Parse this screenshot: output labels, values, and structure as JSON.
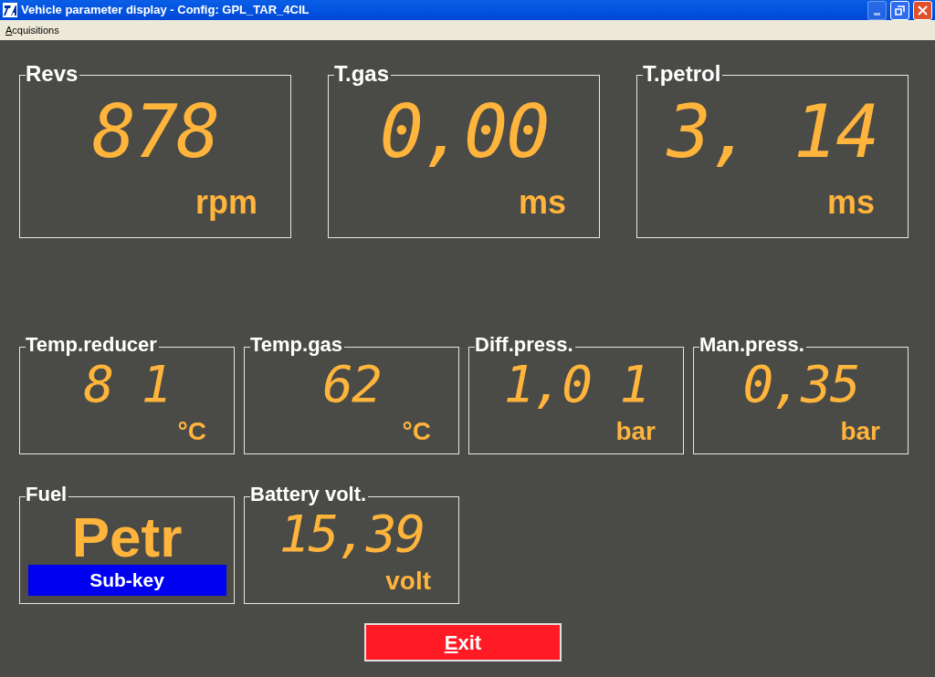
{
  "window": {
    "title": "Vehicle parameter display - Config: GPL_TAR_4CIL"
  },
  "menu": [
    {
      "label": "Acquisitions"
    }
  ],
  "top_row": [
    {
      "kind": "gauge",
      "title": "Revs",
      "value": "878",
      "unit": "rpm"
    },
    {
      "kind": "gauge",
      "title": "T.gas",
      "value": "0,00",
      "unit": "ms"
    },
    {
      "kind": "gauge",
      "title": "T.petrol",
      "value": "3, 14",
      "unit": "ms"
    }
  ],
  "middle_row": [
    {
      "kind": "gauge",
      "title": "Temp.reducer",
      "value": "8 1",
      "unit": "°C"
    },
    {
      "kind": "gauge",
      "title": "Temp.gas",
      "value": "62",
      "unit": "°C"
    },
    {
      "kind": "gauge",
      "title": "Diff.press.",
      "value": "1,0 1",
      "unit": "bar"
    },
    {
      "kind": "gauge",
      "title": "Man.press.",
      "value": "0,35",
      "unit": "bar"
    }
  ],
  "bottom_row": [
    {
      "kind": "fuel",
      "title": "Fuel",
      "value": "Petr",
      "status": "Sub-key"
    },
    {
      "kind": "gauge",
      "title": "Battery volt.",
      "value": "15,39",
      "unit": "volt"
    }
  ],
  "exit_button": {
    "label": "Exit"
  }
}
